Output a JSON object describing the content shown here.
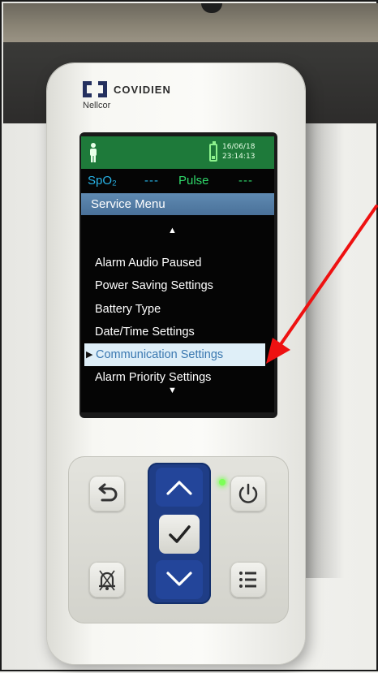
{
  "device": {
    "brand": "COVIDIEN",
    "sub_brand": "Nellcor"
  },
  "status_bar": {
    "date": "16/06/18",
    "time": "23:14:13"
  },
  "params": {
    "spo2_label": "SpO₂",
    "spo2_value": "---",
    "pulse_label": "Pulse",
    "pulse_value": "---"
  },
  "menu": {
    "title": "Service Menu",
    "scroll_up": "▲",
    "scroll_down": "▼",
    "items": [
      {
        "label": "Alarm Audio Paused"
      },
      {
        "label": "Power Saving Settings"
      },
      {
        "label": "Battery Type"
      },
      {
        "label": "Date/Time Settings"
      },
      {
        "label": "Communication Settings"
      },
      {
        "label": "Alarm Priority Settings"
      }
    ],
    "selected_index": 4
  },
  "colors": {
    "topbar": "#1e7a3a",
    "spo2": "#28b4e8",
    "pulse": "#2fd86a",
    "menu_title": "#4a7199",
    "selection": "#dfeff8",
    "annotation_arrow": "#ee1111"
  },
  "icons": {
    "patient": "person-icon",
    "battery": "battery-icon",
    "back": "back-arrow-icon",
    "alarm_silence": "alarm-silence-icon",
    "up": "chevron-up-icon",
    "ok": "checkmark-icon",
    "down": "chevron-down-icon",
    "power": "power-icon",
    "menu": "menu-list-icon"
  }
}
